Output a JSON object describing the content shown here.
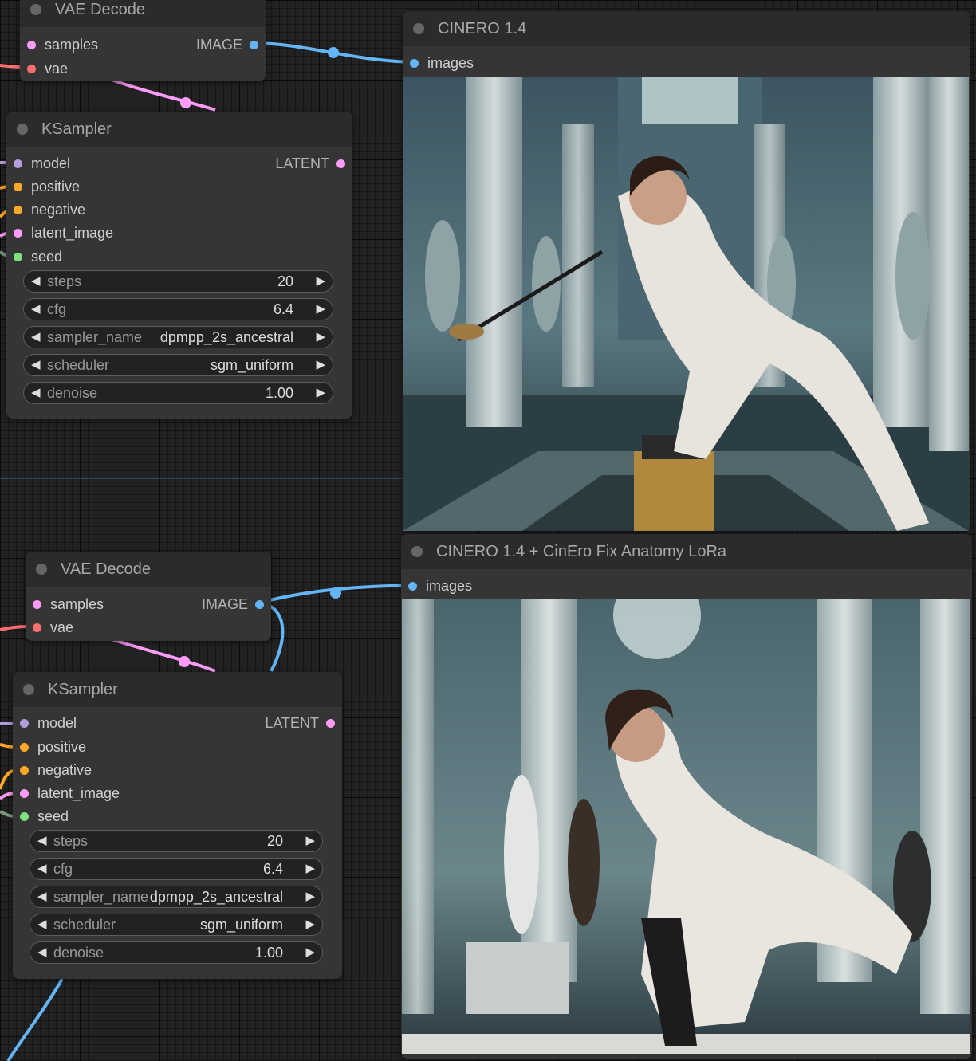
{
  "colors": {
    "model": "#b39ddb",
    "clip": "#ffa726",
    "latent": "#ff9cf9",
    "vae": "#ff6e6e",
    "image": "#64b5f6",
    "int": "#7ee07e"
  },
  "top": {
    "vae_decode": {
      "title": "VAE Decode",
      "inputs": [
        "samples",
        "vae"
      ],
      "output": "IMAGE"
    },
    "ksampler": {
      "title": "KSampler",
      "inputs": [
        "model",
        "positive",
        "negative",
        "latent_image",
        "seed"
      ],
      "output": "LATENT",
      "widgets": [
        {
          "label": "steps",
          "value": "20"
        },
        {
          "label": "cfg",
          "value": "6.4"
        },
        {
          "label": "sampler_name",
          "value": "dpmpp_2s_ancestral"
        },
        {
          "label": "scheduler",
          "value": "sgm_uniform"
        },
        {
          "label": "denoise",
          "value": "1.00"
        }
      ]
    },
    "preview": {
      "title": "CINERO 1.4",
      "input": "images"
    }
  },
  "bottom": {
    "vae_decode": {
      "title": "VAE Decode",
      "inputs": [
        "samples",
        "vae"
      ],
      "output": "IMAGE"
    },
    "ksampler": {
      "title": "KSampler",
      "inputs": [
        "model",
        "positive",
        "negative",
        "latent_image",
        "seed"
      ],
      "output": "LATENT",
      "widgets": [
        {
          "label": "steps",
          "value": "20"
        },
        {
          "label": "cfg",
          "value": "6.4"
        },
        {
          "label": "sampler_name",
          "value": "dpmpp_2s_ancestral"
        },
        {
          "label": "scheduler",
          "value": "sgm_uniform"
        },
        {
          "label": "denoise",
          "value": "1.00"
        }
      ]
    },
    "preview": {
      "title": "CINERO 1.4 + CinEro Fix Anatomy LoRa",
      "input": "images"
    }
  },
  "icons": {
    "decrement": "left-arrow-icon",
    "increment": "right-arrow-icon",
    "collapse": "node-collapse-dot-icon"
  }
}
